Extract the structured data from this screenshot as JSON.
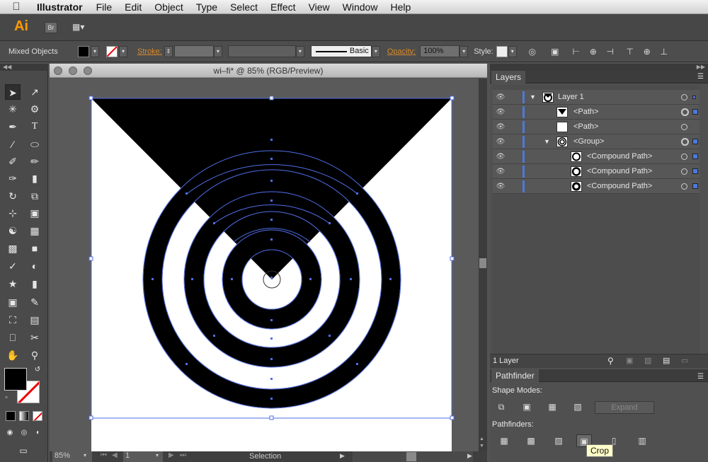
{
  "menubar": {
    "app": "Illustrator",
    "items": [
      "File",
      "Edit",
      "Object",
      "Type",
      "Select",
      "Effect",
      "View",
      "Window",
      "Help"
    ]
  },
  "appbar": {
    "logo": "Ai",
    "bridge": "Br"
  },
  "controlbar": {
    "selection": "Mixed Objects",
    "stroke_label": "Stroke:",
    "brush": "Basic",
    "opacity_label": "Opacity:",
    "opacity_value": "100%",
    "style_label": "Style:"
  },
  "document": {
    "title": "wi–fi* @ 85% (RGB/Preview)",
    "zoom": "85%",
    "page": "1",
    "status": "Selection"
  },
  "layers_panel": {
    "title": "Layers",
    "rows": [
      {
        "name": "Layer 1"
      },
      {
        "name": "<Path>"
      },
      {
        "name": "<Path>"
      },
      {
        "name": "<Group>"
      },
      {
        "name": "<Compound Path>"
      },
      {
        "name": "<Compound Path>"
      },
      {
        "name": "<Compound Path>"
      }
    ],
    "footer": "1 Layer"
  },
  "pathfinder": {
    "title": "Pathfinder",
    "shape_modes": "Shape Modes:",
    "expand": "Expand",
    "pathfinders": "Pathfinders:",
    "tooltip": "Crop"
  },
  "colors": {
    "accent": "#4d7ad8",
    "logo": "#ff9a00"
  }
}
